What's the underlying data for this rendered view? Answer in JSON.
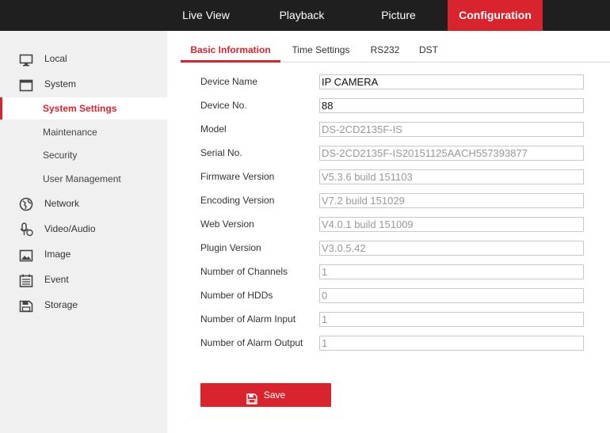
{
  "topnav": {
    "items": [
      {
        "label": "Live View"
      },
      {
        "label": "Playback"
      },
      {
        "label": "Picture"
      },
      {
        "label": "Configuration"
      }
    ],
    "active": "Configuration"
  },
  "sidebar": {
    "items": [
      {
        "label": "Local",
        "icon": "monitor-icon"
      },
      {
        "label": "System",
        "icon": "system-icon"
      },
      {
        "label": "System Settings",
        "sub": true,
        "active": true
      },
      {
        "label": "Maintenance",
        "sub": true
      },
      {
        "label": "Security",
        "sub": true
      },
      {
        "label": "User Management",
        "sub": true
      },
      {
        "label": "Network",
        "icon": "globe-icon"
      },
      {
        "label": "Video/Audio",
        "icon": "microphone-icon"
      },
      {
        "label": "Image",
        "icon": "image-icon"
      },
      {
        "label": "Event",
        "icon": "calendar-icon"
      },
      {
        "label": "Storage",
        "icon": "floppy-icon"
      }
    ]
  },
  "tabs": [
    {
      "label": "Basic Information",
      "active": true
    },
    {
      "label": "Time Settings"
    },
    {
      "label": "RS232"
    },
    {
      "label": "DST"
    }
  ],
  "form": {
    "rows": [
      {
        "label": "Device Name",
        "value": "IP CAMERA",
        "editable": true
      },
      {
        "label": "Device No.",
        "value": "88",
        "editable": true
      },
      {
        "label": "Model",
        "value": "DS-2CD2135F-IS",
        "editable": false
      },
      {
        "label": "Serial No.",
        "value": "DS-2CD2135F-IS20151125AACH557393877",
        "editable": false
      },
      {
        "label": "Firmware Version",
        "value": "V5.3.6 build 151103",
        "editable": false
      },
      {
        "label": "Encoding Version",
        "value": "V7.2 build 151029",
        "editable": false
      },
      {
        "label": "Web Version",
        "value": "V4.0.1 build 151009",
        "editable": false
      },
      {
        "label": "Plugin Version",
        "value": "V3.0.5.42",
        "editable": false
      },
      {
        "label": "Number of Channels",
        "value": "1",
        "editable": false
      },
      {
        "label": "Number of HDDs",
        "value": "0",
        "editable": false
      },
      {
        "label": "Number of Alarm Input",
        "value": "1",
        "editable": false
      },
      {
        "label": "Number of Alarm Output",
        "value": "1",
        "editable": false
      }
    ]
  },
  "save_button": {
    "label": "Save",
    "icon": "floppy-icon"
  },
  "colors": {
    "accent": "#d9232d",
    "topbar": "#1f1f1f",
    "sidebar": "#f0f0f0"
  }
}
